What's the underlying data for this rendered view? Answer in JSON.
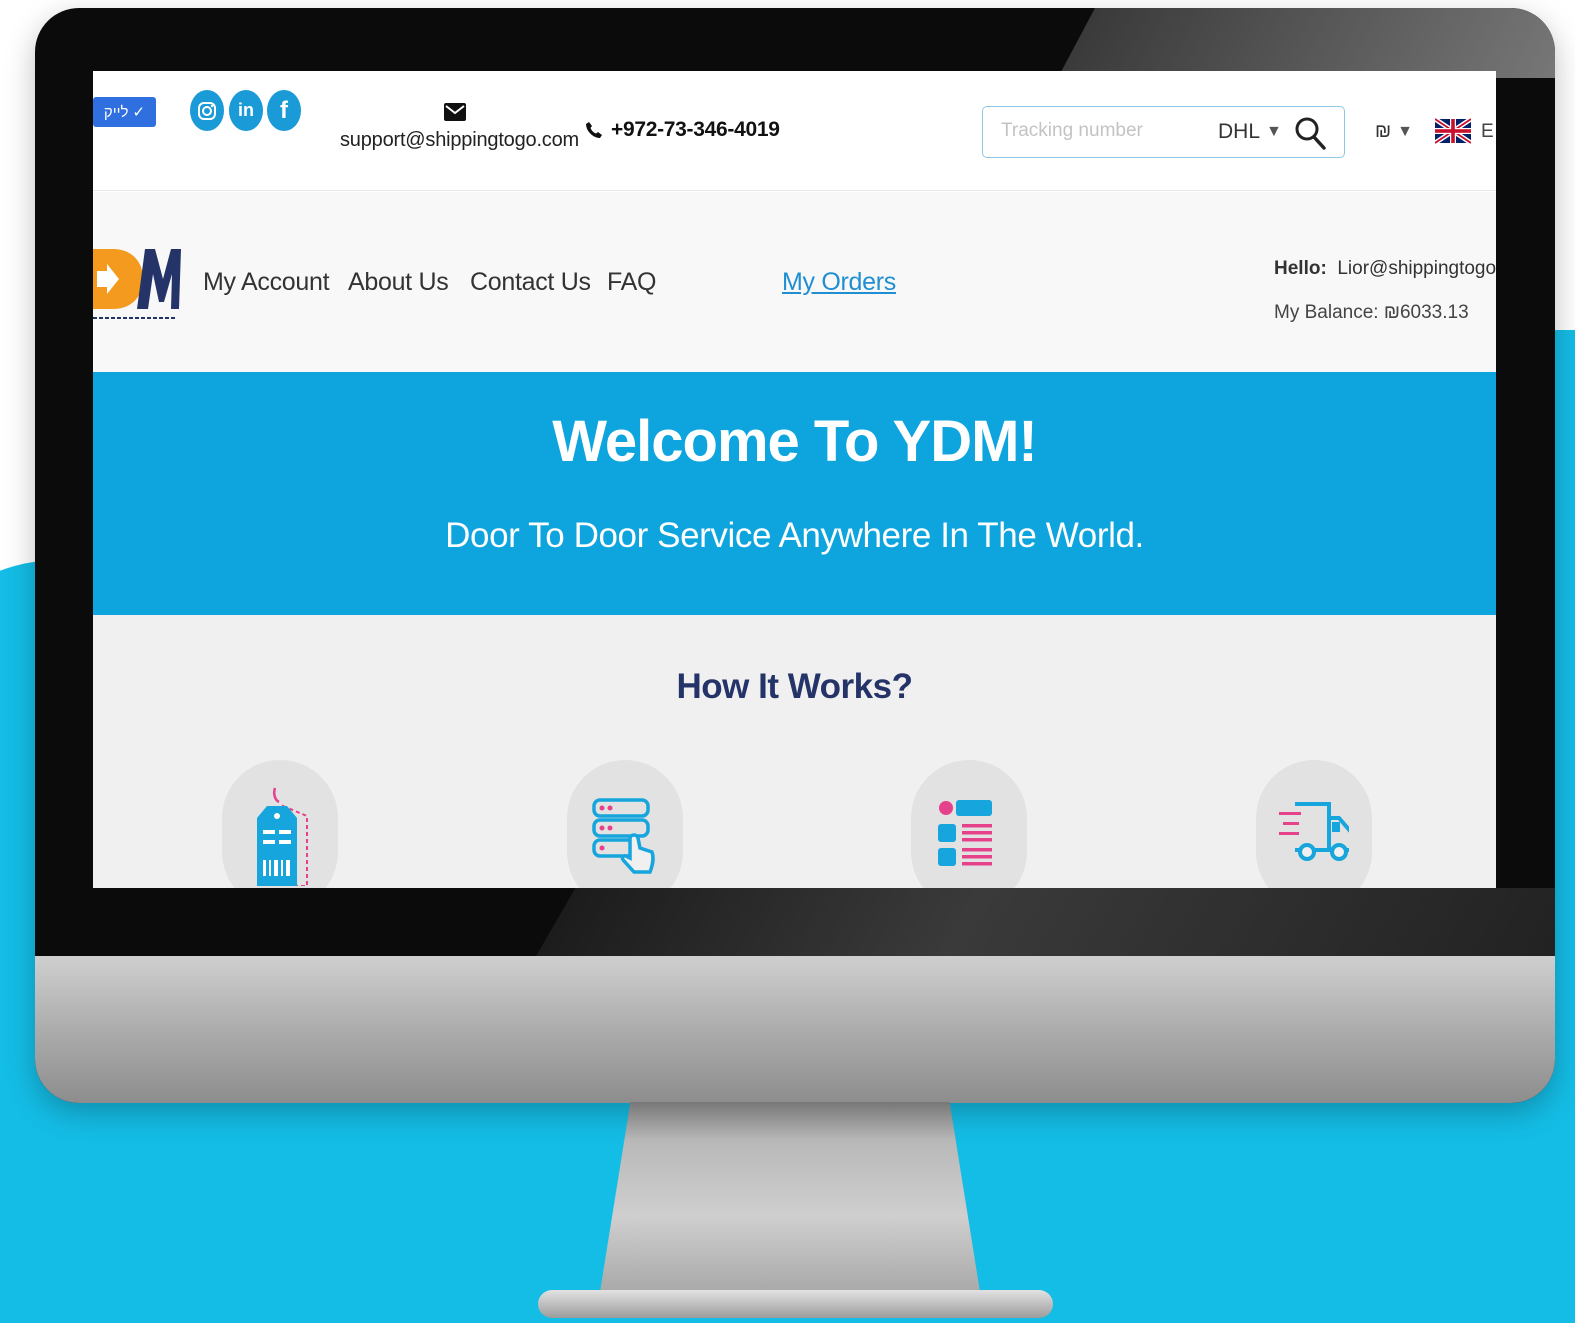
{
  "topbar": {
    "like_label": "לייק",
    "email": "support@shippingtogo.com",
    "phone": "+972-73-346-4019",
    "tracking_placeholder": "Tracking number",
    "carrier": "DHL",
    "currency": "₪",
    "language": "E"
  },
  "nav": {
    "items": [
      "My Account",
      "About Us",
      "Contact Us",
      "FAQ"
    ],
    "my_orders": "My Orders",
    "hello_label": "Hello:",
    "hello_user": "Lior@shippingtogo.co",
    "balance": "My Balance: ₪6033.13"
  },
  "hero": {
    "title": "Welcome To YDM!",
    "subtitle": "Door To Door Service Anywhere In The World."
  },
  "how": {
    "title": "How It Works?",
    "steps": [
      "price-tag-icon",
      "server-select-icon",
      "list-icon",
      "delivery-truck-icon"
    ]
  },
  "colors": {
    "brand_blue": "#0ea4dd",
    "navy": "#253468",
    "pink": "#e6428c",
    "link_blue": "#1f8fd1"
  }
}
